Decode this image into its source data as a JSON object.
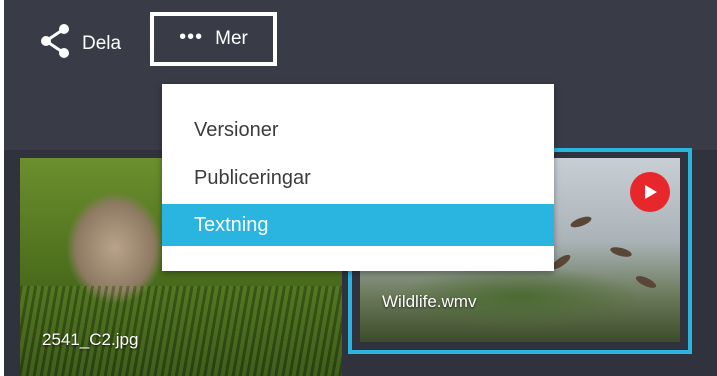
{
  "toolbar": {
    "share_label": "Dela",
    "more_label": "Mer",
    "more_dots": "•••"
  },
  "menu": {
    "items": [
      {
        "label": "Versioner",
        "active": false
      },
      {
        "label": "Publiceringar",
        "active": false
      },
      {
        "label": "Textning",
        "active": true
      }
    ]
  },
  "assets": [
    {
      "name": "2541_C2.jpg",
      "type": "image",
      "selected": false
    },
    {
      "name": "Wildlife.wmv",
      "type": "video",
      "selected": true
    }
  ],
  "icons": {
    "share": "share-icon",
    "more": "more-dots-icon",
    "play": "play-icon"
  },
  "colors": {
    "accent": "#29b5e0",
    "play_badge": "#e8272c",
    "toolbar_bg": "#393b47",
    "content_bg": "#30323e"
  }
}
